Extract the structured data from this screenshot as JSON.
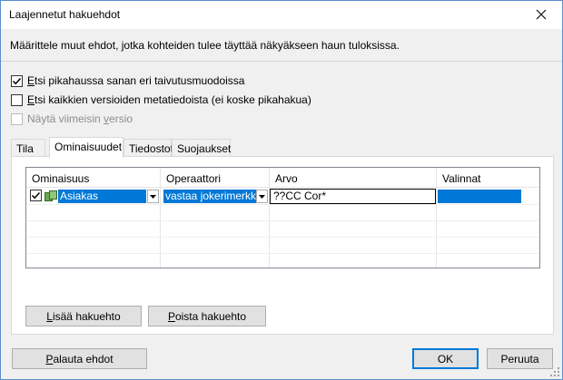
{
  "window": {
    "title": "Laajennetut hakuehdot"
  },
  "description": "Määrittele muut ehdot, jotka kohteiden tulee täyttää näkyäkseen haun tuloksissa.",
  "options": [
    {
      "first": "E",
      "rest": "tsi pikahaussa sanan eri taivutusmuodoissa",
      "checked": true,
      "disabled": false
    },
    {
      "first": "E",
      "rest": "tsi kaikkien versioiden metatiedoista (ei koske pikahakua)",
      "checked": false,
      "disabled": false
    },
    {
      "text": "Näytä viimeisin ",
      "ul": "v",
      "rest": "ersio",
      "checked": false,
      "disabled": true
    }
  ],
  "tabs": [
    "Tila",
    "Ominaisuudet",
    "Tiedostot",
    "Suojaukset"
  ],
  "active_tab": "Ominaisuudet",
  "grid": {
    "columns": [
      "Ominaisuus",
      "Operaattori",
      "Arvo",
      "Valinnat"
    ],
    "row": {
      "checked": true,
      "property": "Asiakas",
      "operator": "vastaa jokerimerkkij...",
      "value": "??CC Cor*"
    }
  },
  "buttons": {
    "add": {
      "ul": "L",
      "rest": "isää hakuehto"
    },
    "remove": {
      "ul": "P",
      "rest": "oista hakuehto"
    },
    "reset": {
      "ul": "P",
      "rest": "alauta ehdot"
    },
    "ok": "OK",
    "cancel": "Peruuta"
  },
  "colors": {
    "selection": "#0078d7",
    "window_border": "#5a8fd0",
    "face": "#f0f0f0"
  },
  "icons": [
    "close-icon",
    "checkmark-icon",
    "property-icon",
    "dropdown-arrow-icon"
  ]
}
